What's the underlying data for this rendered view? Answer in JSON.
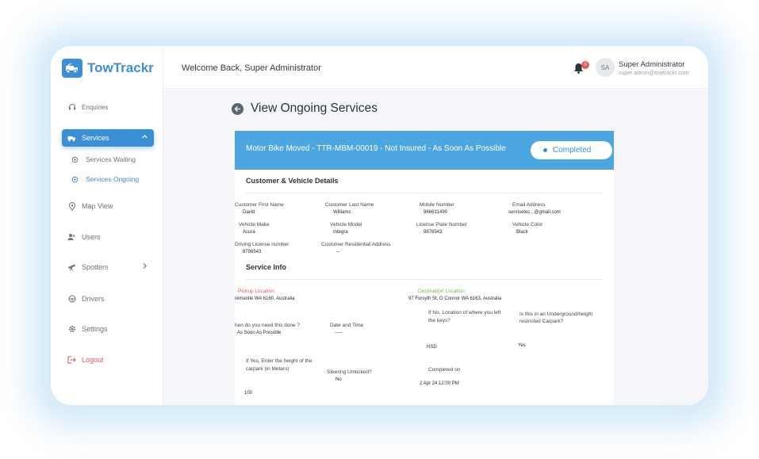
{
  "app": {
    "name": "TowTrackr"
  },
  "sidebar": {
    "items": [
      {
        "label": "Enquiries"
      },
      {
        "label": "Services"
      },
      {
        "label": "Services Waiting"
      },
      {
        "label": "Services Ongoing"
      },
      {
        "label": "Map View"
      },
      {
        "label": "Users"
      },
      {
        "label": "Spotters"
      },
      {
        "label": "Drivers"
      },
      {
        "label": "Settings"
      },
      {
        "label": "Logout"
      }
    ]
  },
  "header": {
    "welcome": "Welcome Back, Super Administrator",
    "notification_count": "0",
    "avatar_initials": "SA",
    "user_name": "Super Administrator",
    "user_email": "super.admin@towtrackr.com"
  },
  "page": {
    "title": "View Ongoing Services",
    "service_title": "Motor Bike Moved - TTR-MBM-00019 - Not Insured - As Soon As Possible",
    "status": "Completed"
  },
  "customer": {
    "section_title": "Customer & Vehicle Details",
    "first_name_label": "Customer First Name",
    "first_name": "David",
    "last_name_label": "Customer Last  Name",
    "last_name": "Williams",
    "mobile_label": "Mobile Number",
    "mobile": "966631490",
    "email_label": "Email Address",
    "email": "sunrisetec...@gmail.com",
    "make_label": "Vehicle Make",
    "make": "Acura",
    "model_label": "Vehicle Model",
    "model": "Integra",
    "plate_label": "License Plate Number",
    "plate": "9876543",
    "color_label": "Vehicle Color",
    "color": "Black",
    "license_label": "Driving License number",
    "license": "8796543",
    "address_label": "Customer Residential Address",
    "address": "--"
  },
  "service": {
    "section_title": "Service Info",
    "pickup_label": "Pickup Location",
    "pickup": "remantle WA 6160, Australia",
    "destination_label": "Destination Location",
    "destination": "97 Forsyth St, O Connor WA 6163, Australia",
    "when_label": "hen do you need this done ?",
    "when": "As Soon As Possible",
    "datetime_label": "Date and Time",
    "datetime": "-----",
    "keys_label_1": "If No, Location of where you left",
    "keys_label_2": "the keys?",
    "keys": "HSD",
    "underground_label_1": "Is this in an Underground/height",
    "underground_label_2": "restricted Carpark?",
    "underground": "Yes",
    "height_label_1": "If Yes, Enter the height of the",
    "height_label_2": "carpark (in Meters)",
    "height": "100",
    "steering_label": "Steering Unlocked?",
    "steering": "No",
    "completed_label": "Completed on",
    "completed": "2 Apr 24 12:00 PM"
  },
  "colors": {
    "accent": "#3a8fd6",
    "header_bar": "#4ca6e0",
    "pickup": "#e25a5a",
    "destination": "#6cbf4a",
    "logout": "#e25a5a"
  }
}
